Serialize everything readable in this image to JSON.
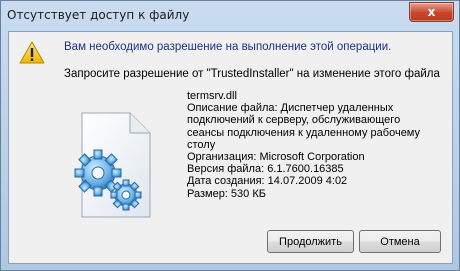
{
  "window": {
    "title": "Отсутствует доступ к файлу",
    "close_label": "x"
  },
  "message": {
    "main": "Вам необходимо разрешение на выполнение этой операции.",
    "sub": "Запросите разрешение от \"TrustedInstaller\" на изменение этого файла"
  },
  "file": {
    "name": "termsrv.dll",
    "description_lines": [
      "Описание файла: Диспетчер удаленных",
      "подключений к серверу, обслуживающего",
      "сеансы подключения к удаленному рабочему",
      "столу"
    ],
    "organization": "Организация: Microsoft Corporation",
    "version": "Версия файла: 6.1.7600.16385",
    "created": "Дата создания: 14.07.2009 4:02",
    "size": "Размер: 530 КБ"
  },
  "buttons": {
    "continue": "Продолжить",
    "cancel": "Отмена"
  },
  "icons": {
    "warning": "warning-icon",
    "file": "file-gears-icon"
  }
}
